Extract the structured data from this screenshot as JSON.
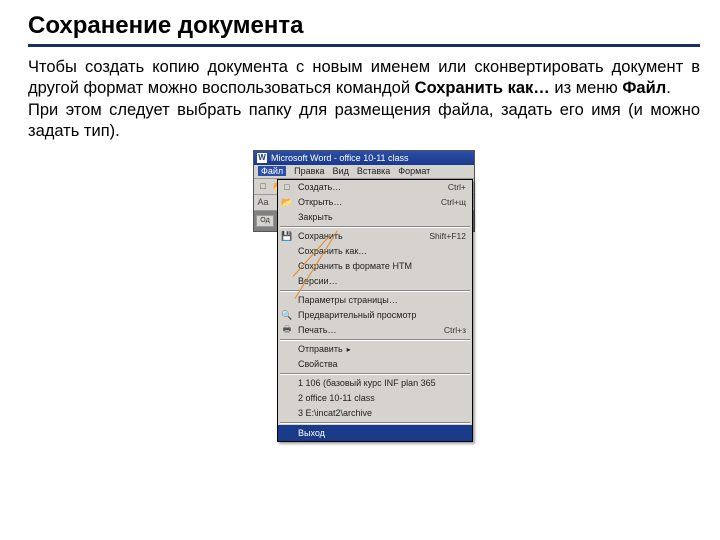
{
  "slide": {
    "title": "Сохранение документа",
    "p1_a": "Чтобы создать копию документа с новым именем или сконвертировать документ в другой формат можно воспользоваться командой ",
    "p1_b": "Сохранить как…",
    "p1_c": " из меню ",
    "p1_d": "Файл",
    "p1_e": ".",
    "p2": "При этом следует выбрать папку для размещения файла, задать его имя (и можно задать тип)."
  },
  "word": {
    "icon": "W",
    "title": "Microsoft Word - office 10-11 class",
    "menus": [
      "Файл",
      "Правка",
      "Вид",
      "Вставка",
      "Формат"
    ],
    "doc_tab": "Од"
  },
  "fileMenu": {
    "items": [
      {
        "icon": "□",
        "label": "Создать…",
        "shortcut": "Ctrl+"
      },
      {
        "icon": "📂",
        "label": "Открыть…",
        "shortcut": "Ctrl+щ"
      },
      {
        "icon": "",
        "label": "Закрыть",
        "shortcut": ""
      },
      {
        "sep": true
      },
      {
        "icon": "💾",
        "label": "Сохранить",
        "shortcut": "Shift+F12"
      },
      {
        "icon": "",
        "label": "Сохранить как…",
        "shortcut": ""
      },
      {
        "icon": "",
        "label": "Сохранить в формате HTM",
        "shortcut": ""
      },
      {
        "icon": "",
        "label": "Версии…",
        "shortcut": ""
      },
      {
        "sep": true
      },
      {
        "icon": "",
        "label": "Параметры страницы…",
        "shortcut": ""
      },
      {
        "icon": "🔍",
        "label": "Предварительный просмотр",
        "shortcut": ""
      },
      {
        "icon": "🖶",
        "label": "Печать…",
        "shortcut": "Ctrl+з"
      },
      {
        "sep": true
      },
      {
        "icon": "",
        "label": "Отправить",
        "shortcut": "",
        "arrow": true
      },
      {
        "icon": "",
        "label": "Свойства",
        "shortcut": ""
      },
      {
        "sep": true
      },
      {
        "icon": "",
        "label": "1 106 (базовый курс INF plan 365",
        "shortcut": ""
      },
      {
        "icon": "",
        "label": "2 office 10-11 class",
        "shortcut": ""
      },
      {
        "icon": "",
        "label": "3 E:\\incat2\\archive",
        "shortcut": ""
      },
      {
        "sep": true
      },
      {
        "icon": "",
        "label": "Выход",
        "shortcut": "",
        "exit": true
      }
    ]
  }
}
